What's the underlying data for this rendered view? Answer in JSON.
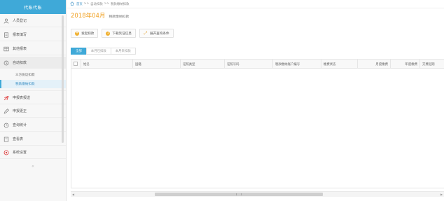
{
  "brand": {
    "title": "代账代账"
  },
  "nav": {
    "items": [
      {
        "label": "人员登记",
        "icon": "user-icon",
        "chevron": ""
      },
      {
        "label": "报表填写",
        "icon": "document-icon",
        "chevron": "⌄"
      },
      {
        "label": "其他报表",
        "icon": "table-icon",
        "chevron": "⌄"
      },
      {
        "label": "自动扣款",
        "icon": "auto-icon",
        "chevron": "⌃"
      }
    ],
    "sub_items": [
      {
        "label": "三方协议扣款"
      },
      {
        "label": "税款缴纳扣款"
      }
    ],
    "items_after": [
      {
        "label": "申报表报送",
        "icon": "send-icon",
        "chevron": ""
      },
      {
        "label": "申报更正",
        "icon": "edit-icon",
        "chevron": ""
      },
      {
        "label": "查询统计",
        "icon": "clock-icon",
        "chevron": "⌄"
      },
      {
        "label": "查看表",
        "icon": "view-icon",
        "chevron": "⌄"
      },
      {
        "label": "系统设置",
        "icon": "settings-icon",
        "chevron": ""
      }
    ],
    "collapse_glyph": "«"
  },
  "breadcrumb": {
    "home": "首页",
    "sep": ">>",
    "level1": "自动扣款",
    "level2": "税款缴纳扣款"
  },
  "period": {
    "year_month": "2018年04月",
    "subtitle": "税款缴纳扣款"
  },
  "toolbar": {
    "buttons": [
      {
        "label": "发起扣款",
        "icon": "coin-icon"
      },
      {
        "label": "下载凭证信息",
        "icon": "download-icon"
      },
      {
        "label": "展开查询条件",
        "icon": "expand-icon"
      }
    ]
  },
  "tabs": [
    {
      "label": "全部",
      "active": true
    },
    {
      "label": "本月已扣款",
      "active": false
    },
    {
      "label": "本月未扣款",
      "active": false
    }
  ],
  "table": {
    "columns": [
      "姓名",
      "国籍",
      "证照类型",
      "证照号码",
      "税款缴纳账户编号",
      "缴费状态",
      "月度缴费",
      "年度缴费",
      "交费起期"
    ]
  },
  "colors": {
    "accent": "#3fa9d8",
    "period": "#f0a020",
    "link": "#3a8fc4"
  }
}
